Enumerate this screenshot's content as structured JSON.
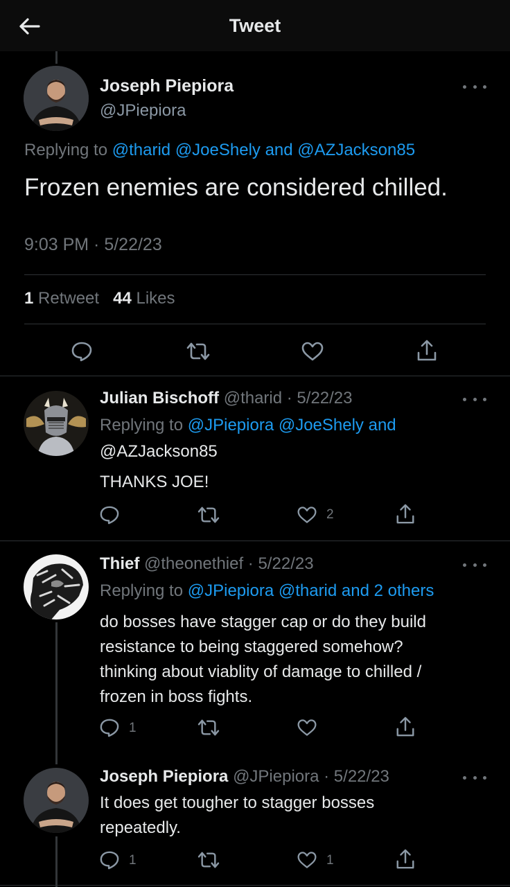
{
  "header": {
    "title": "Tweet"
  },
  "main_tweet": {
    "name": "Joseph Piepiora",
    "handle": "@JPiepiora",
    "replying_prefix": "Replying to",
    "replying_to": "@tharid @JoeShely and @AZJackson85",
    "text": "Frozen enemies are considered chilled.",
    "time": "9:03 PM · 5/22/23",
    "retweets": "1",
    "retweets_label": "Retweet",
    "likes": "44",
    "likes_label": "Likes"
  },
  "replies": [
    {
      "name": "Julian Bischoff",
      "meta": "@tharid · 5/22/23",
      "replying_prefix": "Replying to",
      "replying_line1": "@JPiepiora @JoeShely and",
      "replying_line2": "@AZJackson85",
      "text_lines": [
        "THANKS JOE!"
      ],
      "reply_count": "",
      "like_count": "2"
    },
    {
      "name": "Thief",
      "meta": "@theonethief · 5/22/23",
      "replying_prefix": "Replying to",
      "replying_line1": "@JPiepiora @tharid and 2 others",
      "text_lines": [
        "do bosses have stagger cap or do they build",
        "resistance to being staggered somehow?",
        "thinking about viablity of damage to chilled /",
        "frozen in boss fights."
      ],
      "reply_count": "1",
      "like_count": ""
    },
    {
      "name": "Joseph Piepiora",
      "meta": "@JPiepiora · 5/22/23",
      "text_lines": [
        "It does get tougher to stagger bosses",
        "repeatedly."
      ],
      "reply_count": "1",
      "like_count": "1"
    }
  ],
  "colors": {
    "background": "#000000",
    "link": "#1d9bf0",
    "secondary_text": "#71767b",
    "primary_text": "#e7e9ea"
  }
}
